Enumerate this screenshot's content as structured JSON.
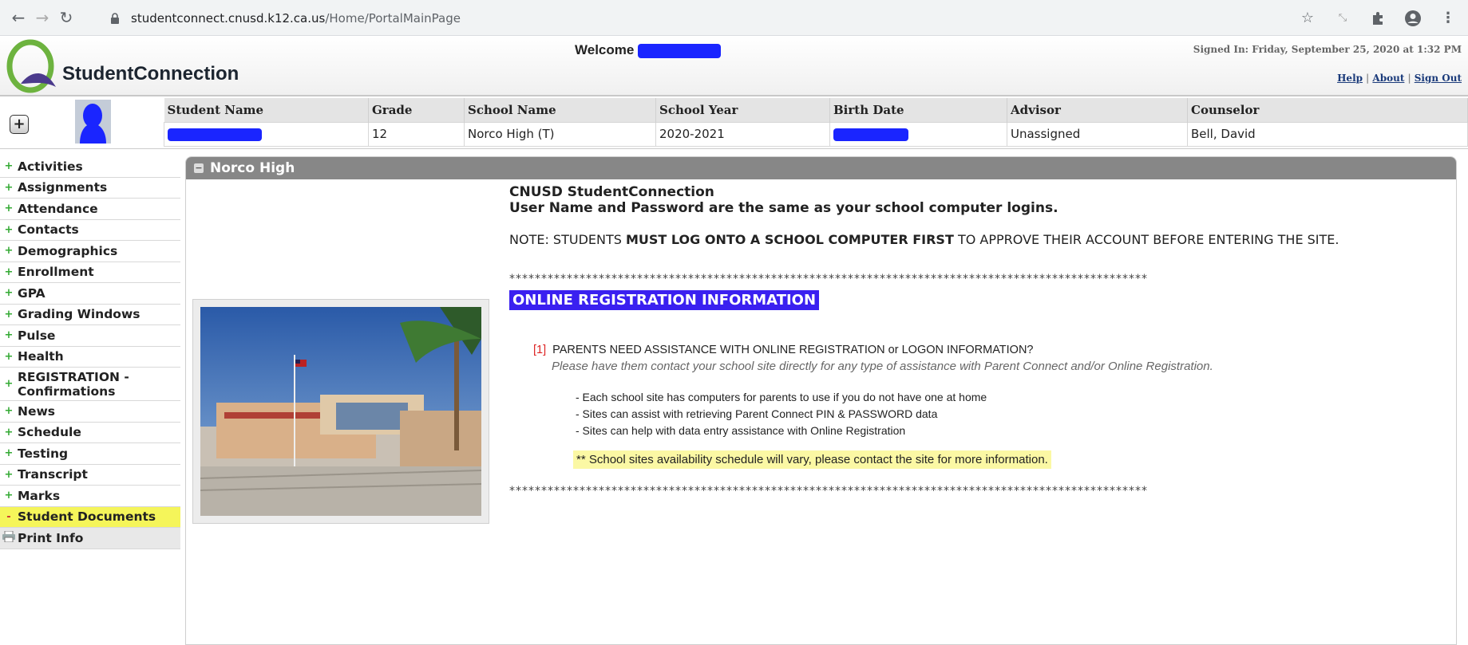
{
  "browser": {
    "url_host": "studentconnect.cnusd.k12.ca.us",
    "url_path": "/Home/PortalMainPage"
  },
  "header": {
    "brand": "StudentConnection",
    "welcome": "Welcome",
    "signed_in": "Signed In: Friday, September 25, 2020 at 1:32 PM",
    "links": [
      "Help",
      "About",
      "Sign Out"
    ]
  },
  "student": {
    "columns": [
      "Student Name",
      "Grade",
      "School Name",
      "School Year",
      "Birth Date",
      "Advisor",
      "Counselor"
    ],
    "grade": "12",
    "school": "Norco High (T)",
    "year": "2020-2021",
    "advisor": "Unassigned",
    "counselor": "Bell, David"
  },
  "sidebar": {
    "items": [
      "Activities",
      "Assignments",
      "Attendance",
      "Contacts",
      "Demographics",
      "Enrollment",
      "GPA",
      "Grading Windows",
      "Pulse",
      "Health",
      "REGISTRATION - Confirmations",
      "News",
      "Schedule",
      "Testing",
      "Transcript",
      "Marks",
      "Student Documents"
    ],
    "print": "Print Info",
    "highlight_color": "#f5f55a"
  },
  "panel": {
    "title": "Norco High",
    "heading1": "CNUSD StudentConnection",
    "heading2": "User Name and Password are the same as your school computer logins.",
    "note_pre": "NOTE: STUDENTS ",
    "note_bold": "MUST LOG ONTO A SCHOOL COMPUTER FIRST",
    "note_post": " TO APPROVE THEIR ACCOUNT BEFORE ENTERING THE SITE.",
    "stars": "****************************************************************************************************",
    "section": "ONLINE REGISTRATION INFORMATION",
    "q_num": "[1]",
    "q_text": "PARENTS NEED ASSISTANCE WITH ONLINE REGISTRATION or LOGON INFORMATION?",
    "q_sub": "Please have them contact your school site directly for any type of assistance with Parent Connect and/or Online  Registration.",
    "bullets": [
      "- Each school site has computers for parents to use if you do not have one at home",
      "- Sites can assist with retrieving Parent Connect PIN & PASSWORD data",
      "- Sites can help with data entry assistance with Online Registration"
    ],
    "availability": "** School sites availability schedule will vary, please contact the site for more information."
  }
}
